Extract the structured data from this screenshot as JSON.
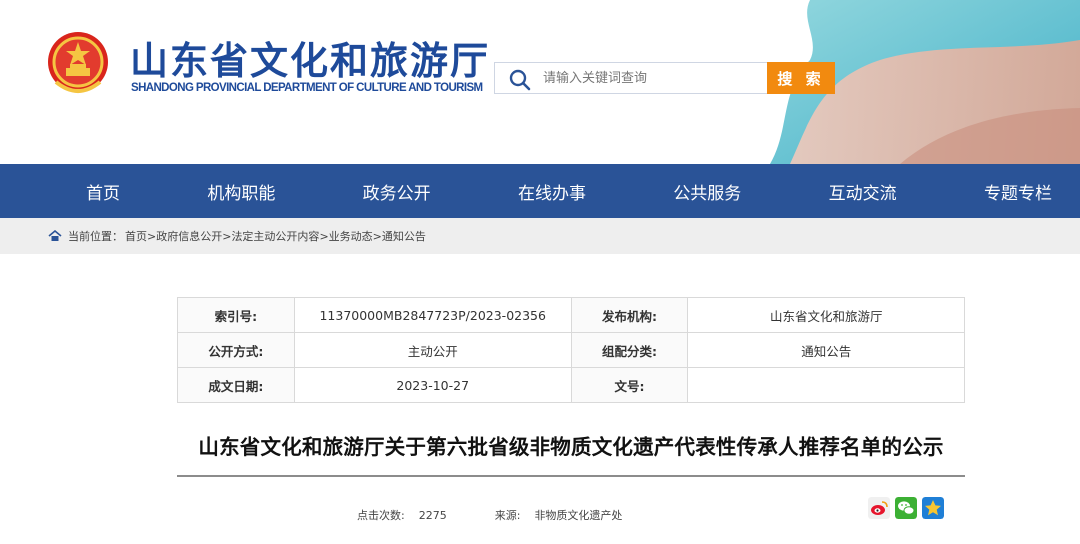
{
  "header": {
    "title": "山东省文化和旅游厅",
    "subtitle": "SHANDONG PROVINCIAL DEPARTMENT OF CULTURE AND TOURISM"
  },
  "search": {
    "placeholder": "请输入关键词查询",
    "button_label": "搜 索"
  },
  "nav": {
    "items": [
      "首页",
      "机构职能",
      "政务公开",
      "在线办事",
      "公共服务",
      "互动交流",
      "专题专栏"
    ]
  },
  "breadcrumb": {
    "label": "当前位置：",
    "items": [
      "首页",
      "政府信息公开",
      "法定主动公开内容",
      "业务动态",
      "通知公告"
    ],
    "separator": ">"
  },
  "meta": {
    "rows": [
      [
        {
          "k": "索引号:",
          "v": "11370000MB2847723P/2023-02356"
        },
        {
          "k": "发布机构:",
          "v": "山东省文化和旅游厅"
        }
      ],
      [
        {
          "k": "公开方式:",
          "v": "主动公开"
        },
        {
          "k": "组配分类:",
          "v": "通知公告"
        }
      ],
      [
        {
          "k": "成文日期:",
          "v": "2023-10-27"
        },
        {
          "k": "文号:",
          "v": ""
        }
      ]
    ]
  },
  "article": {
    "title": "山东省文化和旅游厅关于第六批省级非物质文化遗产代表性传承人推荐名单的公示",
    "views_label": "点击次数:",
    "views": "2275",
    "source_label": "来源:",
    "source": "非物质文化遗产处"
  },
  "share": {
    "icons": [
      "weibo-icon",
      "wechat-icon",
      "favorite-icon"
    ]
  },
  "colors": {
    "brand_blue": "#2a5397",
    "title_blue": "#1e4a9a",
    "accent_orange": "#f28a0f"
  }
}
